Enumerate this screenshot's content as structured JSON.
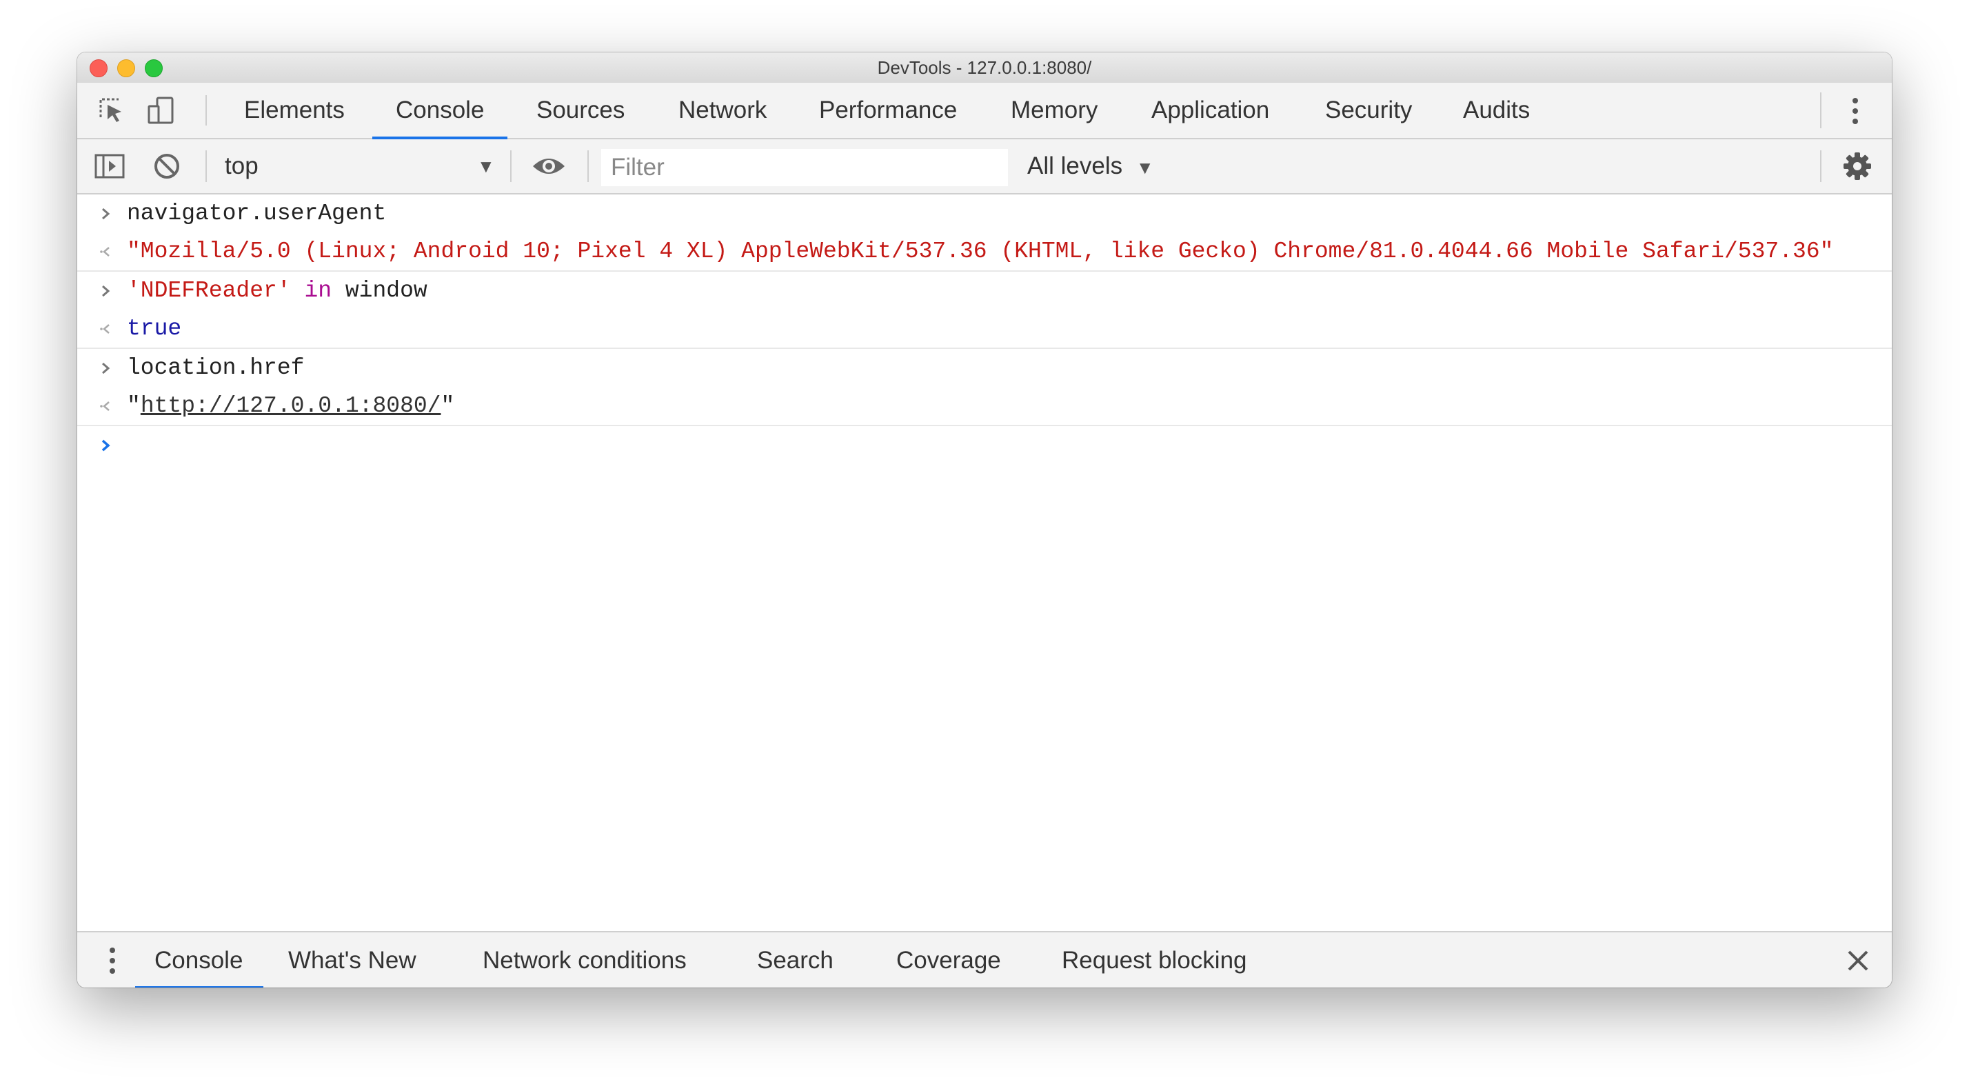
{
  "window": {
    "title": "DevTools - 127.0.0.1:8080/"
  },
  "toolbar": {
    "inspect_icon": "inspect-element-icon",
    "device_icon": "device-toolbar-icon",
    "tabs": [
      {
        "label": "Elements"
      },
      {
        "label": "Console",
        "active": true
      },
      {
        "label": "Sources"
      },
      {
        "label": "Network"
      },
      {
        "label": "Performance"
      },
      {
        "label": "Memory"
      },
      {
        "label": "Application"
      },
      {
        "label": "Security"
      },
      {
        "label": "Audits"
      }
    ],
    "menu_icon": "more-vertical-icon"
  },
  "console_toolbar": {
    "sidebar_icon": "show-sidebar-icon",
    "clear_icon": "clear-console-icon",
    "context": "top",
    "live_expression_icon": "eye-icon",
    "filter": {
      "value": "",
      "placeholder": "Filter"
    },
    "levels": "All levels",
    "settings_icon": "gear-icon"
  },
  "entries": [
    {
      "input": "navigator.userAgent",
      "output": "\"Mozilla/5.0 (Linux; Android 10; Pixel 4 XL) AppleWebKit/537.36 (KHTML, like Gecko) Chrome/81.0.4044.66 Mobile Safari/537.36\""
    },
    {
      "input_string": "'NDEFReader'",
      "input_keyword": "in",
      "input_rest": "window",
      "output": "true"
    },
    {
      "input": "location.href",
      "output_quote_open": "\"",
      "output_link": "http://127.0.0.1:8080/",
      "output_quote_close": "\""
    }
  ],
  "prompt_icon": "prompt-chevron-icon",
  "drawer": {
    "menu_icon": "more-vertical-icon",
    "tabs": [
      {
        "label": "Console",
        "active": true
      },
      {
        "label": "What's New"
      },
      {
        "label": "Network conditions"
      },
      {
        "label": "Search"
      },
      {
        "label": "Coverage"
      },
      {
        "label": "Request blocking"
      }
    ],
    "close_icon": "close-icon"
  },
  "colors": {
    "accent": "#1a73e8",
    "string": "#c41a16",
    "keyword": "#aa0d91",
    "boolean": "#1a1aa6"
  }
}
